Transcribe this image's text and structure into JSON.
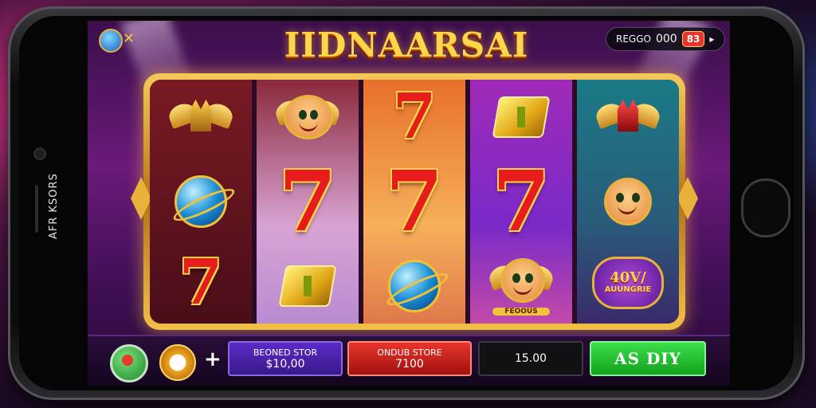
{
  "device": {
    "side_text": "AFR KSORS"
  },
  "header": {
    "title": "IIDNAARSAI",
    "balance_label": "REGGO",
    "balance_value": "000",
    "balance_badge": "83",
    "balance_arrow": "▸"
  },
  "reels": {
    "bonus_badge_top": "40V/",
    "bonus_badge_bottom": "AUUNGRIE",
    "cat_label": "FEOOUS"
  },
  "controls": {
    "plus_label": "+",
    "panel1_label": "BEONED STOR",
    "panel1_value": "$10,00",
    "panel2_label": "ONDUB STORE",
    "panel2_value": "7100",
    "panel3_value": "15.00",
    "spin_label": "AS DIY"
  },
  "colors": {
    "title_gold": "#ffd54a",
    "seven_red": "#e81c1c",
    "spin_green": "#14a21e",
    "bet_purple": "#3a1a8a",
    "win_red": "#a0120e"
  }
}
